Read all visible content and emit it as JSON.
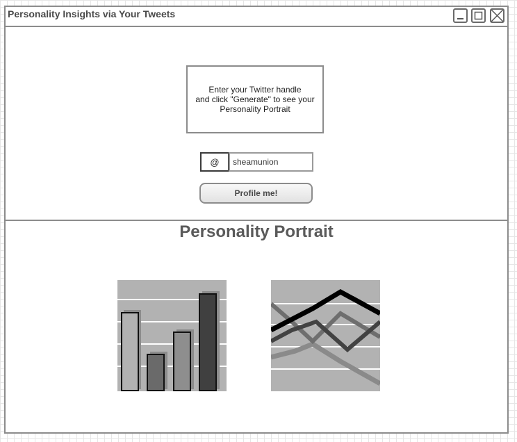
{
  "window": {
    "title": "Personality Insights via Your Tweets"
  },
  "form": {
    "instructions": "Enter your Twitter handle\nand click \"Generate\" to see your\nPersonality Portrait",
    "handle_prefix": "@",
    "handle_value": "sheamunion",
    "submit_label": "Profile me!"
  },
  "portrait": {
    "title": "Personality Portrait",
    "bar_chart_icon": "bar-chart-icon",
    "line_chart_icon": "line-chart-icon"
  },
  "colors": {
    "border": "#8c8c8c",
    "chart_background": "#b2b2b2",
    "title_text": "#5a5a5a"
  }
}
